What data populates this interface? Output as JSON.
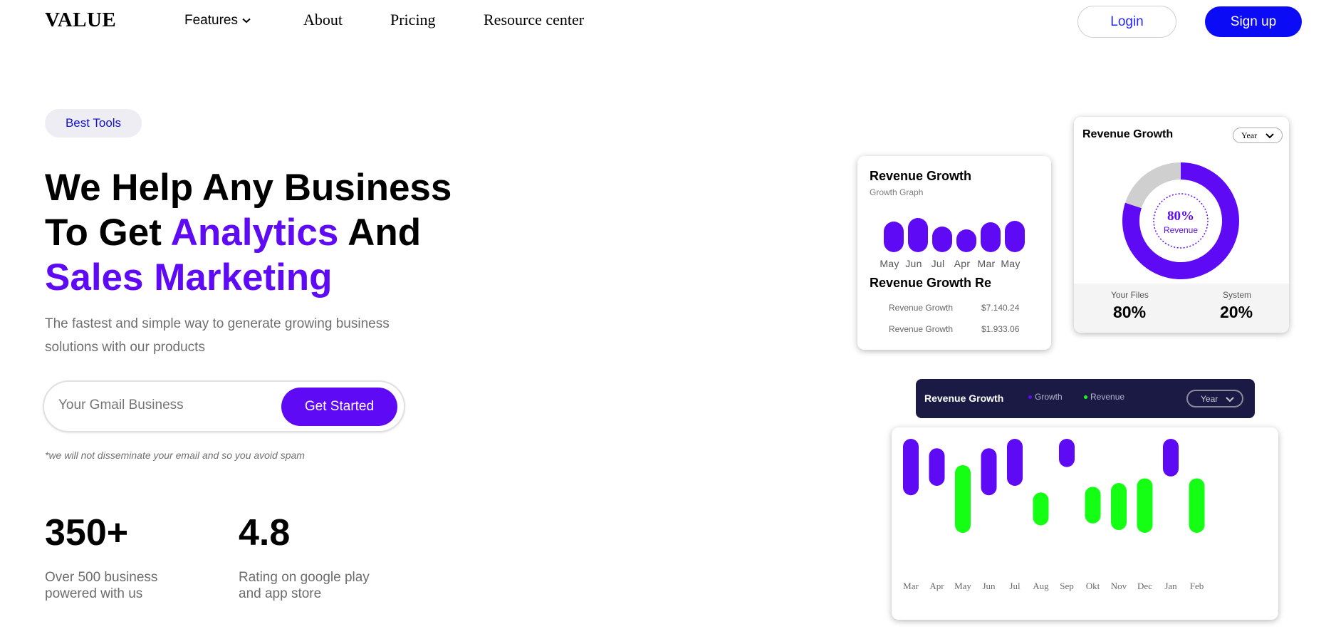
{
  "nav": {
    "logo": "VALUE",
    "items": [
      "Features",
      "About",
      "Pricing",
      "Resource center"
    ],
    "login": "Login",
    "signup": "Sign up"
  },
  "hero": {
    "badge": "Best Tools",
    "title_line1": "We Help Any Business",
    "title_line2_a": "To Get ",
    "title_line2_b": "Analytics",
    "title_line2_c": " And",
    "title_line3": "Sales Marketing",
    "subtitle": "The fastest and simple way to generate growing business solutions with our products",
    "email_placeholder": "Your Gmail Business",
    "cta": "Get Started",
    "disclaimer": "*we will not disseminate your email and so you avoid spam"
  },
  "stats": [
    {
      "value": "350+",
      "line1": "Over 500 business",
      "line2": "powered with us"
    },
    {
      "value": "4.8",
      "line1": "Rating on google play",
      "line2": "and app store"
    }
  ],
  "card_growth": {
    "title": "Revenue Growth",
    "subtitle": "Growth Graph",
    "title2": "Revenue Growth Re",
    "rows": [
      {
        "label": "Revenue Growth",
        "value": "$7.140.24"
      },
      {
        "label": "Revenue Growth",
        "value": "$1.933.06"
      }
    ]
  },
  "card_donut": {
    "title": "Revenue Growth",
    "select": "Year",
    "center_value": "80%",
    "center_label": "Revenue",
    "files_label": "Your Files",
    "files_value": "80%",
    "system_label": "System",
    "system_value": "20%"
  },
  "dark_bar": {
    "title": "Revenue Growth",
    "legend_growth": "Growth",
    "legend_revenue": "Revenue",
    "select": "Year"
  },
  "colors": {
    "purple": "#5f0af5",
    "green": "#14ff14",
    "blue": "#0b0bf5",
    "navy": "#1b1a45",
    "grey": "#cfcfcf"
  },
  "chart_data": [
    {
      "type": "bar",
      "title": "Revenue Growth",
      "subtitle": "Growth Graph",
      "categories": [
        "May",
        "Jun",
        "Jul",
        "Apr",
        "Mar",
        "May"
      ],
      "values": [
        36,
        40,
        30,
        27,
        35,
        37
      ]
    },
    {
      "type": "pie",
      "title": "Revenue Growth",
      "categories": [
        "Your Files",
        "System"
      ],
      "values": [
        80,
        20
      ]
    },
    {
      "type": "bar",
      "title": "Revenue Growth",
      "categories": [
        "Mar",
        "Apr",
        "May",
        "Jun",
        "Jul",
        "Aug",
        "Sep",
        "Okt",
        "Nov",
        "Dec",
        "Jan",
        "Feb"
      ],
      "series": [
        {
          "name": "Growth",
          "color": "#5f0af5",
          "ranges": [
            [
              40,
              100
            ],
            [
              50,
              90
            ],
            null,
            [
              40,
              90
            ],
            [
              50,
              100
            ],
            null,
            [
              70,
              100
            ],
            null,
            null,
            null,
            [
              60,
              100
            ],
            null
          ]
        },
        {
          "name": "Revenue",
          "color": "#14ff14",
          "ranges": [
            null,
            null,
            [
              0,
              72
            ],
            null,
            null,
            [
              8,
              43
            ],
            null,
            [
              10,
              49
            ],
            [
              3,
              53
            ],
            [
              0,
              58
            ],
            null,
            [
              0,
              58
            ]
          ]
        }
      ]
    }
  ]
}
